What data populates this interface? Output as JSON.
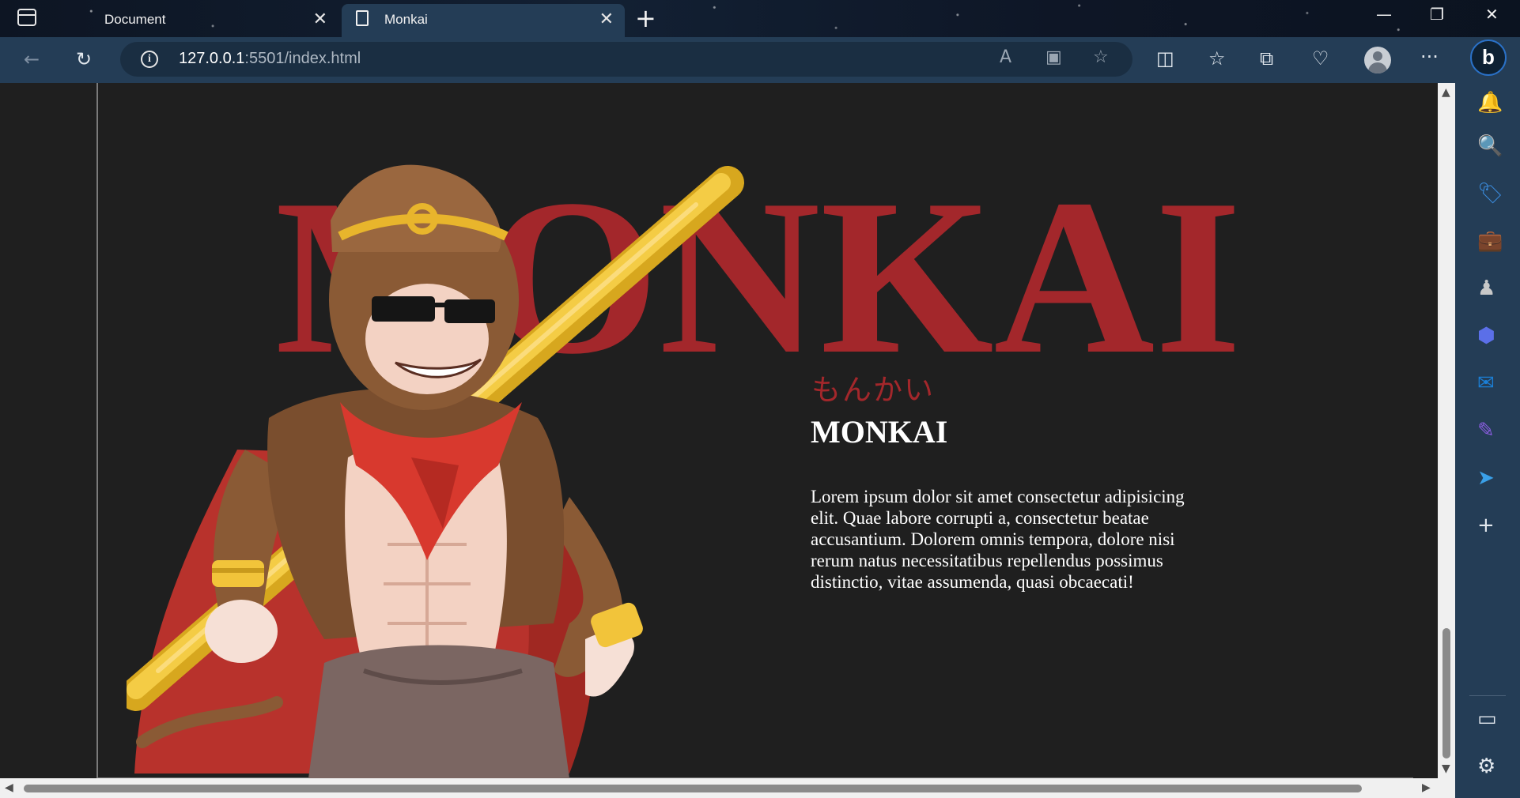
{
  "browser": {
    "tabs": [
      {
        "title": "Document",
        "active": false
      },
      {
        "title": "Monkai",
        "active": true
      }
    ],
    "url_host": "127.0.0.1",
    "url_path": ":5501/index.html"
  },
  "icons": {
    "tab_actions": "tab-actions-icon",
    "close": "close-icon",
    "new_tab": "plus-icon",
    "back": "back-arrow-icon",
    "refresh": "refresh-icon",
    "info": "info-icon",
    "read_aloud": "read-aloud-icon",
    "immersive_reader": "immersive-reader-icon",
    "favorite": "star-icon",
    "split_screen": "split-screen-icon",
    "favorites": "favorites-icon",
    "collections": "collections-icon",
    "browser_essentials": "heart-pulse-icon",
    "profile": "avatar",
    "more": "ellipsis-icon",
    "bing": "bing-icon"
  },
  "sidebar": [
    {
      "name": "bell-icon",
      "glyph": "🔔",
      "color": "#5ab4f0"
    },
    {
      "name": "search-icon",
      "glyph": "🔍",
      "color": "#5ab4f0"
    },
    {
      "name": "shopping-tag-icon",
      "glyph": "🏷",
      "color": "#3b8de0"
    },
    {
      "name": "tools-briefcase-icon",
      "glyph": "💼",
      "color": "#e8643c"
    },
    {
      "name": "games-icon",
      "glyph": "♟",
      "color": "#c8c8c8"
    },
    {
      "name": "microsoft-365-icon",
      "glyph": "⬢",
      "color": "#5b6fe8"
    },
    {
      "name": "outlook-icon",
      "glyph": "✉",
      "color": "#1b7fd6"
    },
    {
      "name": "designer-icon",
      "glyph": "✎",
      "color": "#8a5de0"
    },
    {
      "name": "send-icon",
      "glyph": "➤",
      "color": "#3aa0e8"
    },
    {
      "name": "add-icon",
      "glyph": "+",
      "color": "#e2e8ee"
    },
    {
      "name": "sidebar-toggle-icon",
      "glyph": "▭",
      "color": "#e2e8ee"
    },
    {
      "name": "settings-gear-icon",
      "glyph": "⚙",
      "color": "#e2e8ee"
    }
  ],
  "page": {
    "hero_title": "MONKAI",
    "kana": "もんかい",
    "heading": "MONKAI",
    "description": "Lorem ipsum dolor sit amet consectetur adipisicing elit. Quae labore corrupti a, consectetur beatae accusantium. Dolorem omnis tempora, dolore nisi rerum natus necessitatibus repellendus possimus distinctio, vitae assumenda, quasi obcaecati!"
  },
  "colors": {
    "accent_red": "#a3272b",
    "page_bg": "#1f1f1f",
    "browser_chrome": "#243d56"
  }
}
